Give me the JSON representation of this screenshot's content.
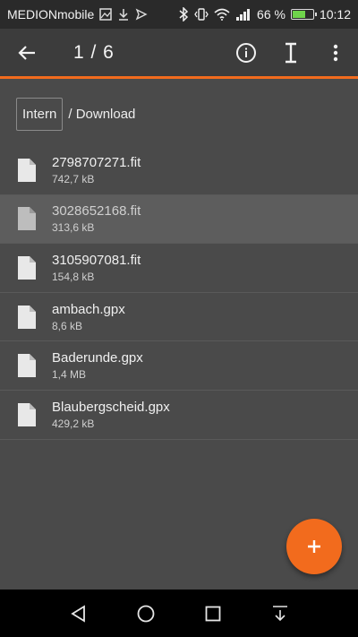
{
  "status_bar": {
    "carrier": "MEDIONmobile",
    "battery_percent": "66 %",
    "battery_level": 0.66,
    "time": "10:12"
  },
  "app_bar": {
    "counter": "1 / 6"
  },
  "breadcrumb": {
    "root": "Intern",
    "path": "/ Download"
  },
  "files": [
    {
      "name": "2798707271.fit",
      "size": "742,7 kB"
    },
    {
      "name": "3028652168.fit",
      "size": "313,6 kB"
    },
    {
      "name": "3105907081.fit",
      "size": "154,8 kB"
    },
    {
      "name": "ambach.gpx",
      "size": "8,6 kB"
    },
    {
      "name": "Baderunde.gpx",
      "size": "1,4 MB"
    },
    {
      "name": "Blaubergscheid.gpx",
      "size": "429,2 kB"
    }
  ],
  "colors": {
    "accent": "#f26b1d",
    "background": "#4a4a4a",
    "app_bar": "#3c3c3c",
    "selected_row": "#5d5d5d"
  },
  "icons": [
    "image-icon",
    "download-icon",
    "send-icon",
    "bluetooth-icon",
    "vibrate-icon",
    "wifi-icon",
    "signal-icon",
    "battery-icon",
    "back-arrow-icon",
    "info-icon",
    "text-cursor-icon",
    "more-vert-icon",
    "file-icon",
    "plus-icon",
    "nav-back-icon",
    "nav-home-icon",
    "nav-recents-icon",
    "nav-notifications-icon"
  ]
}
